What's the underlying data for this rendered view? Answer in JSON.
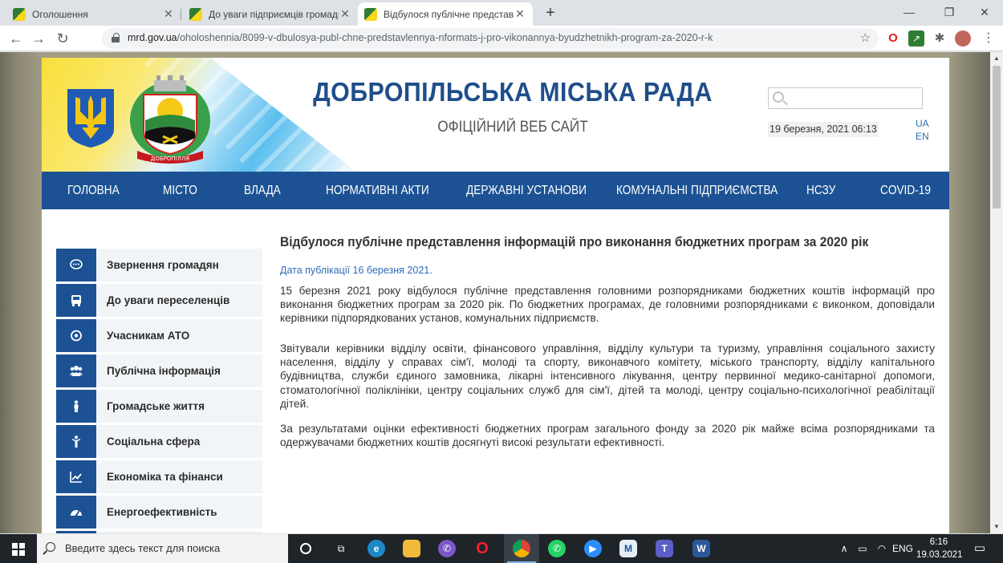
{
  "browser": {
    "tabs": [
      {
        "title": "Оголошення"
      },
      {
        "title": "До уваги підприємців громади!"
      },
      {
        "title": "Відбулося публічне представле"
      }
    ],
    "url_domain": "mrd.gov.ua",
    "url_path": "/oholoshennia/8099-v-dbulosya-publ-chne-predstavlennya-nformats-j-pro-vikonannya-byudzhetnikh-program-za-2020-r-k"
  },
  "header": {
    "title": "ДОБРОПІЛЬСЬКА МІСЬКА РАДА",
    "subtitle": "ОФІЦІЙНИЙ ВЕБ САЙТ",
    "search_placeholder": "",
    "date": "19 березня, 2021 06:13",
    "lang_ua": "UA",
    "lang_en": "EN",
    "coat_caption": "ДОБРОПІЛЛЯ"
  },
  "nav": [
    "ГОЛОВНА",
    "МІСТО",
    "ВЛАДА",
    "НОРМАТИВНІ АКТИ",
    "ДЕРЖАВНІ УСТАНОВИ",
    "КОМУНАЛЬНІ ПІДПРИЄМСТВА",
    "НСЗУ",
    "COVID-19"
  ],
  "sidebar": [
    {
      "label": "Звернення громадян",
      "icon": "chat-icon"
    },
    {
      "label": "До уваги переселенців",
      "icon": "bus-icon"
    },
    {
      "label": "Учасникам АТО",
      "icon": "target-icon"
    },
    {
      "label": "Публічна інформація",
      "icon": "users-icon"
    },
    {
      "label": "Громадське життя",
      "icon": "person-icon"
    },
    {
      "label": "Соціальна сфера",
      "icon": "figure-icon"
    },
    {
      "label": "Економіка та фінанси",
      "icon": "chart-line-icon"
    },
    {
      "label": "Енергоефективність",
      "icon": "gauge-icon"
    }
  ],
  "article": {
    "title": "Відбулося публічне представлення інформацій про виконання бюджетних програм за 2020 рік",
    "pubdate": "Дата публікації 16 березня 2021.",
    "paragraphs": [
      "15 березня 2021 року відбулося публічне представлення головними розпорядниками бюджетних коштів інформацій про виконання бюджетних програм за 2020 рік. По бюджетних програмах, де головними розпорядниками є виконком, доповідали керівники підпорядкованих установ, комунальних підприємств.",
      "Звітували керівники відділу освіти, фінансового управління, відділу культури та туризму, управління соціального захисту населення, відділу у справах сім'ї, молоді та спорту, виконавчого комітету, міського транспорту, відділу капітального будівництва, служби єдиного замовника, лікарні інтенсивного лікування, центру первинної медико-санітарної допомоги, стоматологічної поліклініки, центру соціальних служб для сім'ї, дітей та молоді, центру соціально-психологічної реабілітації дітей.",
      "За результатами оцінки ефективності бюджетних програм загального фонду за 2020 рік майже всіма розпорядниками та одержувачами бюджетних коштів досягнуті високі результати ефективності."
    ]
  },
  "taskbar": {
    "search_text": "Введите здесь текст для поиска",
    "lang": "ENG",
    "time": "6:16",
    "date": "19.03.2021"
  },
  "colors": {
    "brand_blue": "#1c5294",
    "title_blue": "#1f4e8a",
    "link_blue": "#2c6bb7"
  }
}
